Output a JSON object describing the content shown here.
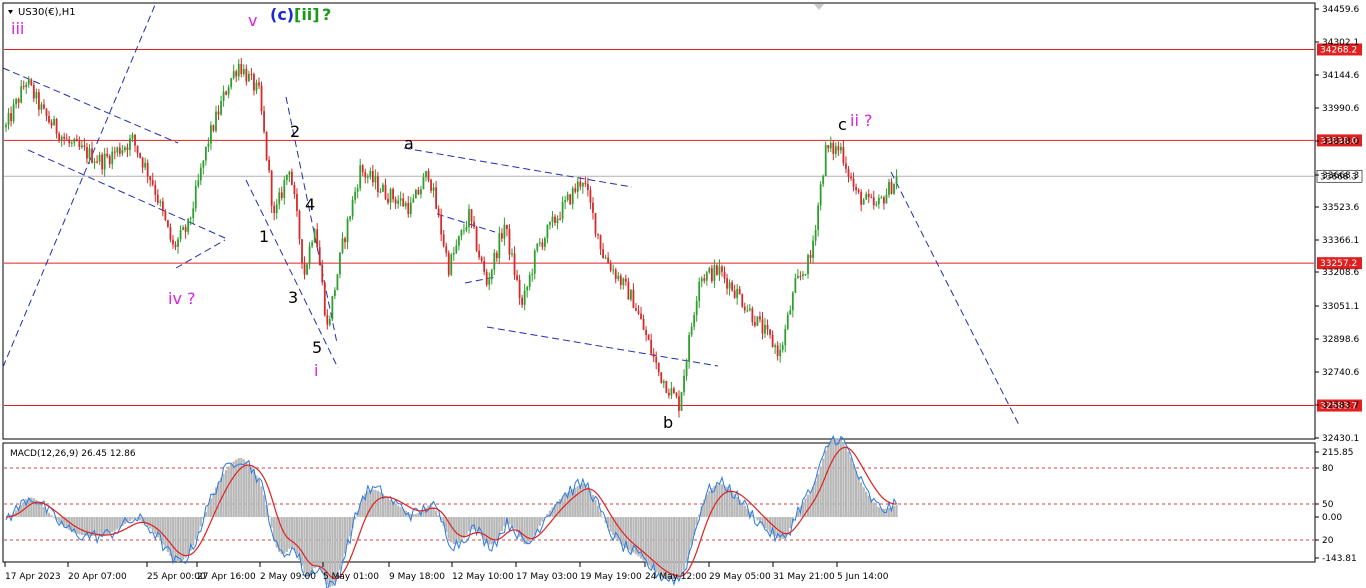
{
  "window": {
    "symbol_title": "US30(€),H1",
    "collapse_icon": "triangle-down-icon"
  },
  "chart_data": [
    {
      "type": "candlestick",
      "title": "US30(€),H1",
      "ylim": [
        32430.1,
        34459.6
      ],
      "y_ticks": [
        "34459.6",
        "34302.1",
        "34144.6",
        "33990.6",
        "33838.0",
        "33668.3",
        "33523.6",
        "33366.1",
        "33208.6",
        "33051.1",
        "32898.6",
        "32740.6",
        "32583.7",
        "32430.1"
      ],
      "x_ticks": [
        "17 Apr 2023",
        "20 Apr 07:00",
        "25 Apr 00:00",
        "27 Apr 16:00",
        "2 May 09:00",
        "5 May 01:00",
        "9 May 18:00",
        "12 May 10:00",
        "17 May 03:00",
        "19 May 19:00",
        "24 May 12:00",
        "29 May 05:00",
        "31 May 21:00",
        "5 Jun 14:00"
      ],
      "colors": {
        "up": "#2e9e2e",
        "down": "#d42a2a",
        "level_line": "#e02020",
        "trend_line": "#1f2fb0",
        "current_price_line": "#b0b0b0"
      },
      "price_path": [
        {
          "bar": 0,
          "price": 33900
        },
        {
          "bar": 8,
          "price": 34120
        },
        {
          "bar": 15,
          "price": 33960
        },
        {
          "bar": 25,
          "price": 33820
        },
        {
          "bar": 38,
          "price": 33740
        },
        {
          "bar": 50,
          "price": 33840
        },
        {
          "bar": 58,
          "price": 33640
        },
        {
          "bar": 66,
          "price": 33330
        },
        {
          "bar": 72,
          "price": 33430
        },
        {
          "bar": 80,
          "price": 33840
        },
        {
          "bar": 88,
          "price": 34110
        },
        {
          "bar": 92,
          "price": 34200
        },
        {
          "bar": 100,
          "price": 34060
        },
        {
          "bar": 106,
          "price": 33470
        },
        {
          "bar": 112,
          "price": 33720
        },
        {
          "bar": 118,
          "price": 33210
        },
        {
          "bar": 122,
          "price": 33450
        },
        {
          "bar": 127,
          "price": 32950
        },
        {
          "bar": 133,
          "price": 33340
        },
        {
          "bar": 140,
          "price": 33700
        },
        {
          "bar": 150,
          "price": 33590
        },
        {
          "bar": 160,
          "price": 33520
        },
        {
          "bar": 167,
          "price": 33690
        },
        {
          "bar": 175,
          "price": 33240
        },
        {
          "bar": 183,
          "price": 33480
        },
        {
          "bar": 190,
          "price": 33160
        },
        {
          "bar": 197,
          "price": 33440
        },
        {
          "bar": 204,
          "price": 33050
        },
        {
          "bar": 210,
          "price": 33330
        },
        {
          "bar": 218,
          "price": 33480
        },
        {
          "bar": 228,
          "price": 33660
        },
        {
          "bar": 236,
          "price": 33300
        },
        {
          "bar": 248,
          "price": 33080
        },
        {
          "bar": 258,
          "price": 32740
        },
        {
          "bar": 266,
          "price": 32590
        },
        {
          "bar": 274,
          "price": 33190
        },
        {
          "bar": 282,
          "price": 33220
        },
        {
          "bar": 290,
          "price": 33100
        },
        {
          "bar": 298,
          "price": 32960
        },
        {
          "bar": 306,
          "price": 32830
        },
        {
          "bar": 312,
          "price": 33150
        },
        {
          "bar": 318,
          "price": 33280
        },
        {
          "bar": 324,
          "price": 33790
        },
        {
          "bar": 330,
          "price": 33800
        },
        {
          "bar": 336,
          "price": 33580
        },
        {
          "bar": 344,
          "price": 33520
        },
        {
          "bar": 352,
          "price": 33660
        }
      ],
      "horizontal_levels": [
        {
          "price": 34268.2,
          "label": "34268.2"
        },
        {
          "price": 33838.0,
          "label": "33838.0"
        },
        {
          "price": 33257.2,
          "label": "33257.2"
        },
        {
          "price": 32583.7,
          "label": "32583.7"
        }
      ],
      "current_price": {
        "price": 33668.3,
        "label": "33668.3"
      },
      "wave_labels": [
        {
          "text": "iii",
          "color": "#e020e0"
        },
        {
          "text": "v",
          "color": "#e020e0"
        },
        {
          "text": "(c)",
          "color": "#1a2ad0"
        },
        {
          "text": "[ii]",
          "color": "#1a9a1a"
        },
        {
          "text": "?",
          "color": "#1a9a1a"
        },
        {
          "text": "iv ?",
          "color": "#e020e0"
        },
        {
          "text": "1",
          "color": "#000000"
        },
        {
          "text": "2",
          "color": "#000000"
        },
        {
          "text": "3",
          "color": "#000000"
        },
        {
          "text": "4",
          "color": "#000000"
        },
        {
          "text": "5",
          "color": "#000000"
        },
        {
          "text": "i",
          "color": "#e020e0"
        },
        {
          "text": "a",
          "color": "#000000"
        },
        {
          "text": "b",
          "color": "#000000"
        },
        {
          "text": "c",
          "color": "#000000"
        },
        {
          "text": "ii ?",
          "color": "#e020e0"
        }
      ]
    },
    {
      "type": "histogram",
      "title": "MACD(12,26,9) 26.45 12.86",
      "indicator": "MACD",
      "params": [
        12,
        26,
        9
      ],
      "macd_value": 26.45,
      "signal_value": 12.86,
      "ylim": [
        -143.81,
        215.85
      ],
      "y_ticks": [
        "215.85",
        "80",
        "50",
        "0.00",
        "20",
        "-143.81"
      ],
      "dashed_levels": [
        80,
        50,
        -20
      ],
      "colors": {
        "histogram": "#b8b8b8",
        "signal": "#e02020",
        "macd_line": "#2a7ae0",
        "level": "#d04040"
      }
    }
  ]
}
